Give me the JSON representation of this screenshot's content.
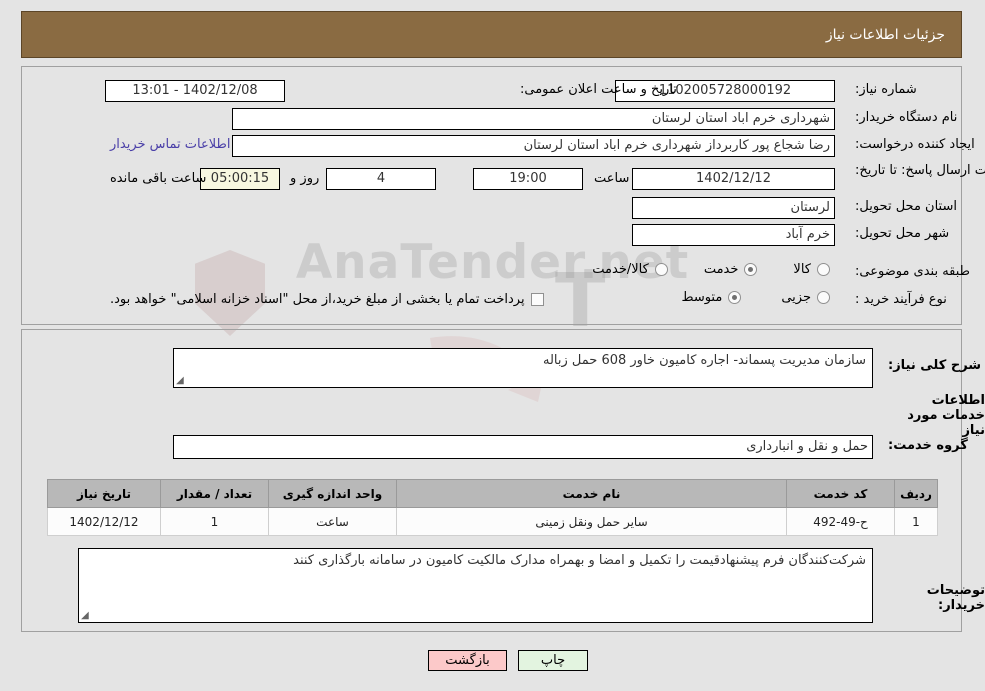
{
  "header": {
    "title": "جزئیات اطلاعات نیاز"
  },
  "watermark": {
    "text": "AnaTender.net"
  },
  "form": {
    "need_number_label": "شماره نیاز:",
    "need_number_value": "1102005728000192",
    "public_announce_label": "تاریخ و ساعت اعلان عمومی:",
    "public_announce_value": "1402/12/08 - 13:01",
    "buyer_org_label": "نام دستگاه خریدار:",
    "buyer_org_value": "شهرداری خرم اباد استان لرستان",
    "requester_label": "ایجاد کننده درخواست:",
    "requester_value": "رضا شجاع پور کاربرداز شهرداری خرم اباد استان لرستان",
    "contact_link": "اطلاعات تماس خریدار",
    "deadline_label": "مهلت ارسال پاسخ: تا تاریخ:",
    "deadline_date": "1402/12/12",
    "hour_label": "ساعت",
    "hour_value": "19:00",
    "days_value": "4",
    "days_label": "روز و",
    "countdown_value": "05:00:15",
    "remaining_label": "ساعت باقی مانده",
    "province_label": "استان محل تحویل:",
    "province_value": "لرستان",
    "city_label": "شهر محل تحویل:",
    "city_value": "خرم آباد",
    "category_label": "طبقه بندی موضوعی:",
    "category_options": [
      {
        "label": "کالا",
        "selected": false
      },
      {
        "label": "خدمت",
        "selected": true
      },
      {
        "label": "کالا/خدمت",
        "selected": false
      }
    ],
    "process_label": "نوع فرآیند خرید :",
    "process_options": [
      {
        "label": "جزیی",
        "selected": false
      },
      {
        "label": "متوسط",
        "selected": true
      }
    ],
    "treasury_checkbox_label": "پرداخت تمام یا بخشی از مبلغ خرید،از محل \"اسناد خزانه اسلامی\" خواهد بود.",
    "treasury_checked": false
  },
  "general_desc": {
    "label": "شرح کلی نیاز:",
    "value": "سازمان مدیریت پسماند- اجاره کامیون خاور 608 حمل زباله"
  },
  "services_section": {
    "heading": "اطلاعات خدمات مورد نیاز",
    "group_label": "گروه خدمت:",
    "group_value": "حمل و نقل و انبارداری"
  },
  "table": {
    "columns": [
      "ردیف",
      "کد خدمت",
      "نام خدمت",
      "واحد اندازه گیری",
      "تعداد / مقدار",
      "تاریخ نیاز"
    ],
    "rows": [
      {
        "row_no": "1",
        "service_code": "ح-49-492",
        "service_name": "سایر حمل ونقل زمینی",
        "unit": "ساعت",
        "quantity": "1",
        "need_date": "1402/12/12"
      }
    ]
  },
  "buyer_notes": {
    "label": "توضیحات خریدار:",
    "value": "شرکت‌کنندگان فرم پیشنهادقیمت را تکمیل و امضا و بهمراه مدارک مالکیت کامیون در سامانه بارگذاری کنند"
  },
  "footer": {
    "back_label": "بازگشت",
    "print_label": "چاپ"
  },
  "colors": {
    "header_bg": "#8a6b42",
    "page_bg": "#e4e4e4",
    "link": "#4a3fa8",
    "back_btn": "#fcc9c9",
    "print_btn": "#e3f4e0"
  }
}
